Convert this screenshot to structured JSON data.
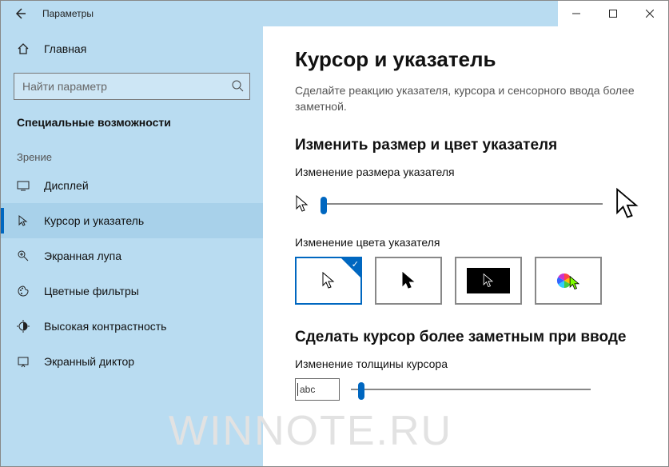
{
  "titlebar": {
    "title": "Параметры"
  },
  "sidebar": {
    "home": "Главная",
    "search_placeholder": "Найти параметр",
    "category": "Специальные возможности",
    "group": "Зрение",
    "items": [
      {
        "label": "Дисплей"
      },
      {
        "label": "Курсор и указатель"
      },
      {
        "label": "Экранная лупа"
      },
      {
        "label": "Цветные фильтры"
      },
      {
        "label": "Высокая контрастность"
      },
      {
        "label": "Экранный диктор"
      }
    ]
  },
  "page": {
    "title": "Курсор и указатель",
    "description": "Сделайте реакцию указателя, курсора и сенсорного ввода более заметной.",
    "section1_title": "Изменить размер и цвет указателя",
    "size_label": "Изменение размера указателя",
    "color_label": "Изменение цвета указателя",
    "section2_title": "Сделать курсор более заметным при вводе",
    "thickness_label": "Изменение толщины курсора",
    "preview_text": "abc"
  },
  "watermark": "WINNOTE.RU"
}
